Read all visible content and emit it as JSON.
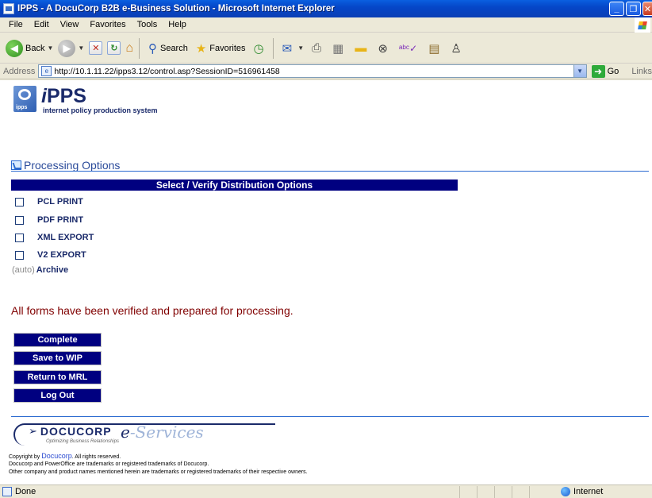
{
  "window": {
    "title": "IPPS - A DocuCorp B2B e-Business Solution - Microsoft Internet Explorer"
  },
  "menu": {
    "items": [
      {
        "label": "File"
      },
      {
        "label": "Edit"
      },
      {
        "label": "View"
      },
      {
        "label": "Favorites"
      },
      {
        "label": "Tools"
      },
      {
        "label": "Help"
      }
    ]
  },
  "toolbar": {
    "back_label": "Back",
    "search_label": "Search",
    "favorites_label": "Favorites"
  },
  "address": {
    "label": "Address",
    "url": "http://10.1.11.22/ipps3.12/control.asp?SessionID=516961458",
    "go_label": "Go",
    "links_label": "Links"
  },
  "logo": {
    "title_prefix": "i",
    "title_main": "PPS",
    "badge": "ipps",
    "subtitle": "internet policy production system"
  },
  "section": {
    "title": "Processing Options"
  },
  "options": {
    "header": "Select / Verify Distribution Options",
    "items": [
      {
        "label": "PCL PRINT",
        "checked": false
      },
      {
        "label": "PDF PRINT",
        "checked": false
      },
      {
        "label": "XML EXPORT",
        "checked": false
      },
      {
        "label": "V2 EXPORT",
        "checked": false
      }
    ],
    "archive_prefix": "(auto)",
    "archive_label": "Archive"
  },
  "message": "All forms have been verified and prepared for processing.",
  "actions": {
    "complete": "Complete",
    "save_wip": "Save to WIP",
    "return_mrl": "Return to MRL",
    "logout": "Log Out"
  },
  "footer": {
    "brand": "DOCUCORP",
    "tagline": "Optimizing Business Relationships",
    "eservices_e": "e",
    "eservices_rest": "-Services",
    "copyright_prefix": "Copyright by",
    "copyright_brand": "Docucorp",
    "copyright_suffix": ". All rights reserved.",
    "trademark_line1": "Docucorp and PowerOffice are trademarks or registered trademarks of Docucorp.",
    "trademark_line2": "Other company and product names mentioned herein are trademarks or registered trademarks of their respective owners."
  },
  "status": {
    "text": "Done",
    "zone": "Internet"
  },
  "colors": {
    "header_bg": "#000080",
    "message": "#800000",
    "section": "#2a4a9a"
  }
}
